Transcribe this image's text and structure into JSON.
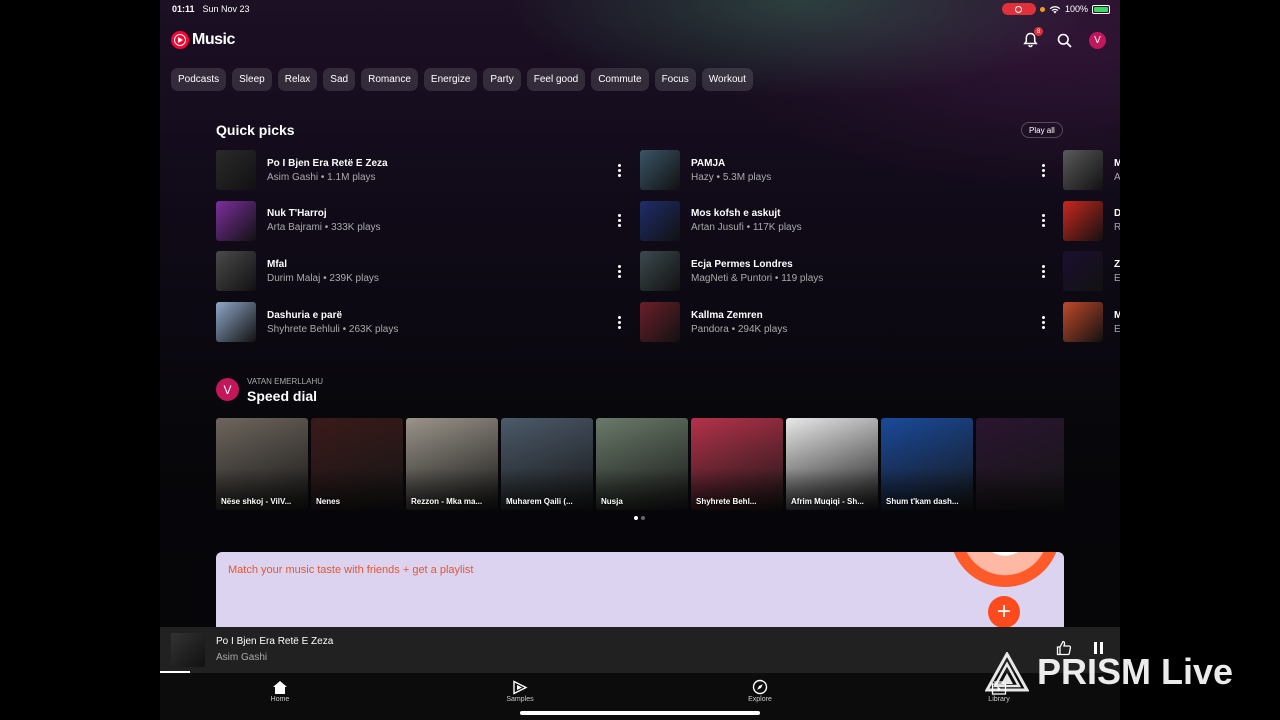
{
  "status_bar": {
    "time": "01:11",
    "date": "Sun Nov 23",
    "battery": "100%",
    "battery_level": 1.0
  },
  "app": {
    "name": "Music"
  },
  "header": {
    "notification_count": "8",
    "avatar_initial": "V"
  },
  "mood_chips": [
    "Podcasts",
    "Sleep",
    "Relax",
    "Sad",
    "Romance",
    "Energize",
    "Party",
    "Feel good",
    "Commute",
    "Focus",
    "Workout"
  ],
  "quick_picks": {
    "title": "Quick picks",
    "play_all_label": "Play all",
    "columns": [
      [
        {
          "title": "Po I Bjen Era Retë E Zeza",
          "subtitle": "Asim Gashi • 1.1M plays",
          "color": "#2a2a2a"
        },
        {
          "title": "Nuk T'Harroj",
          "subtitle": "Arta Bajrami • 333K plays",
          "color": "#7b2f9e"
        },
        {
          "title": "Mfal",
          "subtitle": "Durim Malaj • 239K plays",
          "color": "#4a4a4a"
        },
        {
          "title": "Dashuria e parë",
          "subtitle": "Shyhrete Behluli • 263K plays",
          "color": "#8fa8c8"
        }
      ],
      [
        {
          "title": "PAMJA",
          "subtitle": "Hazy • 5.3M plays",
          "color": "#3a5566"
        },
        {
          "title": "Mos kofsh e askujt",
          "subtitle": "Artan Jusufi • 117K plays",
          "color": "#1f2d6b"
        },
        {
          "title": "Ecja Permes Londres",
          "subtitle": "MagNeti & Puntori • 119 plays",
          "color": "#3b4a4e"
        },
        {
          "title": "Kallma Zemren",
          "subtitle": "Pandora • 294K plays",
          "color": "#6b1f2a"
        }
      ],
      [
        {
          "title": "M",
          "subtitle": "A",
          "color": "#5a5a5a"
        },
        {
          "title": "D",
          "subtitle": "R",
          "color": "#c8281e"
        },
        {
          "title": "Z",
          "subtitle": "E",
          "color": "#1b1030"
        },
        {
          "title": "M",
          "subtitle": "E",
          "color": "#c04a2a"
        }
      ]
    ]
  },
  "speed_dial": {
    "owner": "VATAN EMERLLAHU",
    "owner_initial": "V",
    "title": "Speed dial",
    "tiles": [
      {
        "label": "Nëse shkoj - VilV...",
        "color": "#6e665e"
      },
      {
        "label": "Nenes",
        "color": "#3a1a1a"
      },
      {
        "label": "Rezzon - Mka ma...",
        "color": "#9a948a"
      },
      {
        "label": "Muharem Qaili (...",
        "color": "#4c5a6a"
      },
      {
        "label": "Nusja",
        "color": "#6a7a6a"
      },
      {
        "label": "Shyhrete Behl...",
        "color": "#b4324a"
      },
      {
        "label": "Afrim Muqiqi - Sh...",
        "color": "#e8e8e8"
      },
      {
        "label": "Shum t'kam dash...",
        "color": "#1a4a9a"
      },
      {
        "label": "",
        "color": "#2a1530"
      }
    ]
  },
  "promo": {
    "text": "Match your music taste with friends + get a playlist",
    "fab": "+"
  },
  "mini_player": {
    "title": "Po I Bjen Era Retë E Zeza",
    "artist": "Asim Gashi"
  },
  "bottom_nav": [
    "Home",
    "Samples",
    "Explore",
    "Library"
  ],
  "watermark": {
    "text": "PRISM Live"
  }
}
